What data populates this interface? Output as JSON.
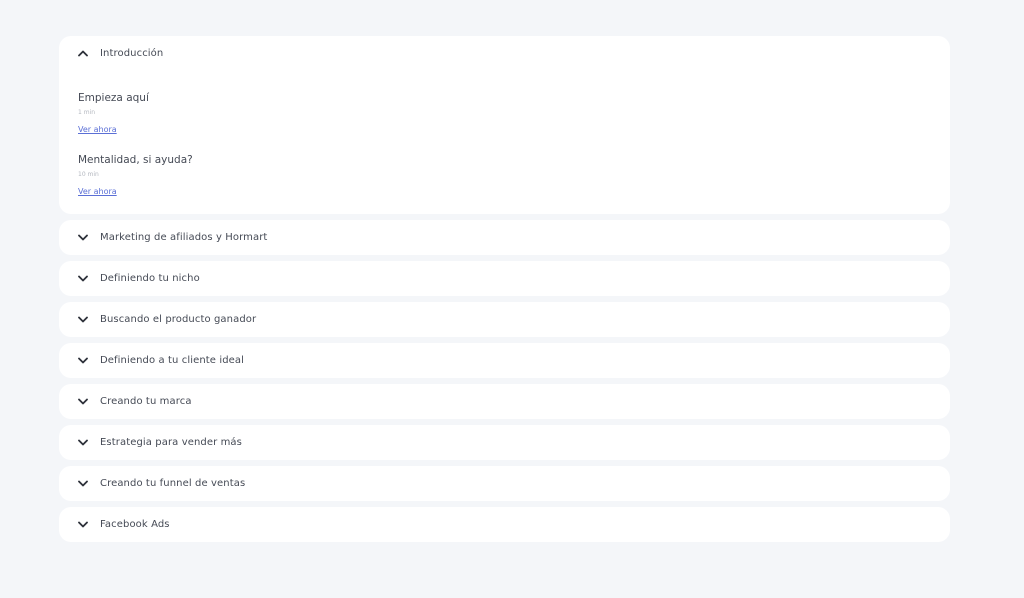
{
  "sections": [
    {
      "title": "Introducción",
      "expanded": true,
      "icon": "chevron-up-icon",
      "lessons": [
        {
          "title": "Empieza aquí",
          "duration": "1 min",
          "link": "Ver ahora"
        },
        {
          "title": "Mentalidad, si ayuda?",
          "duration": "10 min",
          "link": "Ver ahora"
        }
      ]
    },
    {
      "title": "Marketing de afiliados y Hormart",
      "expanded": false,
      "icon": "chevron-down-icon"
    },
    {
      "title": "Definiendo tu nicho",
      "expanded": false,
      "icon": "chevron-down-icon"
    },
    {
      "title": "Buscando el producto ganador",
      "expanded": false,
      "icon": "chevron-down-icon"
    },
    {
      "title": "Definiendo a tu cliente ideal",
      "expanded": false,
      "icon": "chevron-down-icon"
    },
    {
      "title": "Creando tu marca",
      "expanded": false,
      "icon": "chevron-down-icon"
    },
    {
      "title": "Estrategia para vender más",
      "expanded": false,
      "icon": "chevron-down-icon"
    },
    {
      "title": "Creando tu funnel de ventas",
      "expanded": false,
      "icon": "chevron-down-icon"
    },
    {
      "title": "Facebook Ads",
      "expanded": false,
      "icon": "chevron-down-icon"
    }
  ],
  "colors": {
    "background": "#f4f6f9",
    "card": "#ffffff",
    "link": "#5b6fd6",
    "text": "#454a55",
    "muted": "#b3b7bf"
  }
}
